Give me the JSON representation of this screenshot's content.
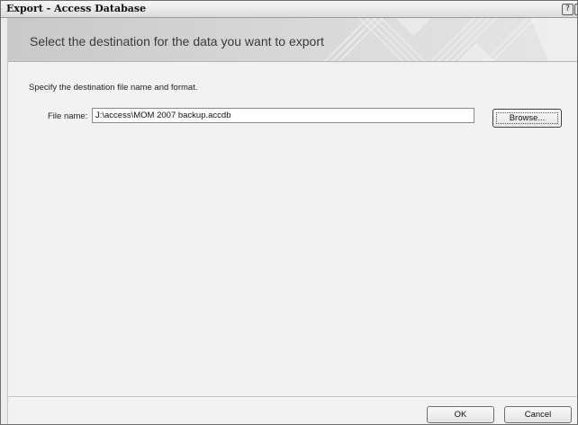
{
  "window": {
    "title": "Export - Access Database",
    "help_glyph": "?",
    "close_glyph": "✕"
  },
  "banner": {
    "text": "Select the destination for the data you want to export"
  },
  "form": {
    "instruction": "Specify the destination file name and format.",
    "file_name_label": "File name:",
    "file_name_value": "J:\\access\\MOM 2007 backup.accdb",
    "browse_label": "Browse..."
  },
  "footer": {
    "ok_label": "OK",
    "cancel_label": "Cancel"
  }
}
